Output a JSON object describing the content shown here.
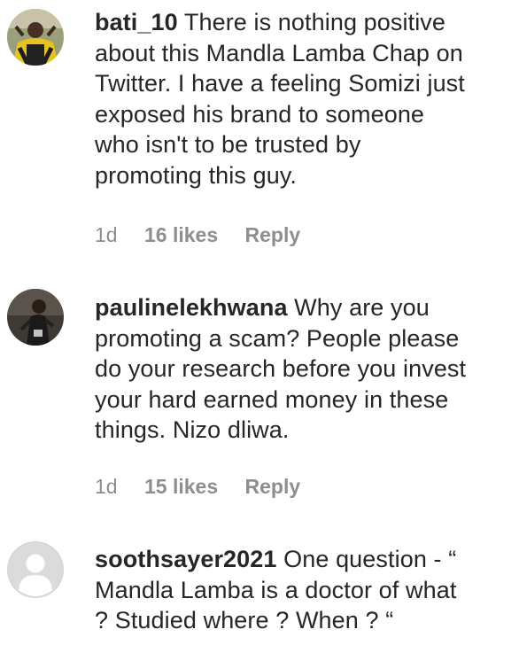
{
  "comments": [
    {
      "username": "bati_10",
      "avatar_icon": "user-photo-yellow-jersey",
      "lines": [
        " There is nothing positive",
        "about this Mandla Lamba Chap on",
        "Twitter. I have a feeling Somizi just",
        "exposed his brand to someone",
        "who isn't to be trusted by",
        "promoting this guy."
      ],
      "time": "1d",
      "likes": "16 likes",
      "reply_label": "Reply"
    },
    {
      "username": "paulinelekhwana",
      "avatar_icon": "user-photo-dark",
      "lines": [
        " Why are you",
        "promoting a scam? People please",
        "do your research before you invest",
        "your hard earned money in these",
        "things. Nizo dliwa."
      ],
      "time": "1d",
      "likes": "15 likes",
      "reply_label": "Reply"
    },
    {
      "username": "soothsayer2021",
      "avatar_icon": "default-user-icon",
      "lines": [
        " One question - “",
        "Mandla Lamba is a doctor of what",
        "? Studied where ? When ? “"
      ]
    }
  ]
}
